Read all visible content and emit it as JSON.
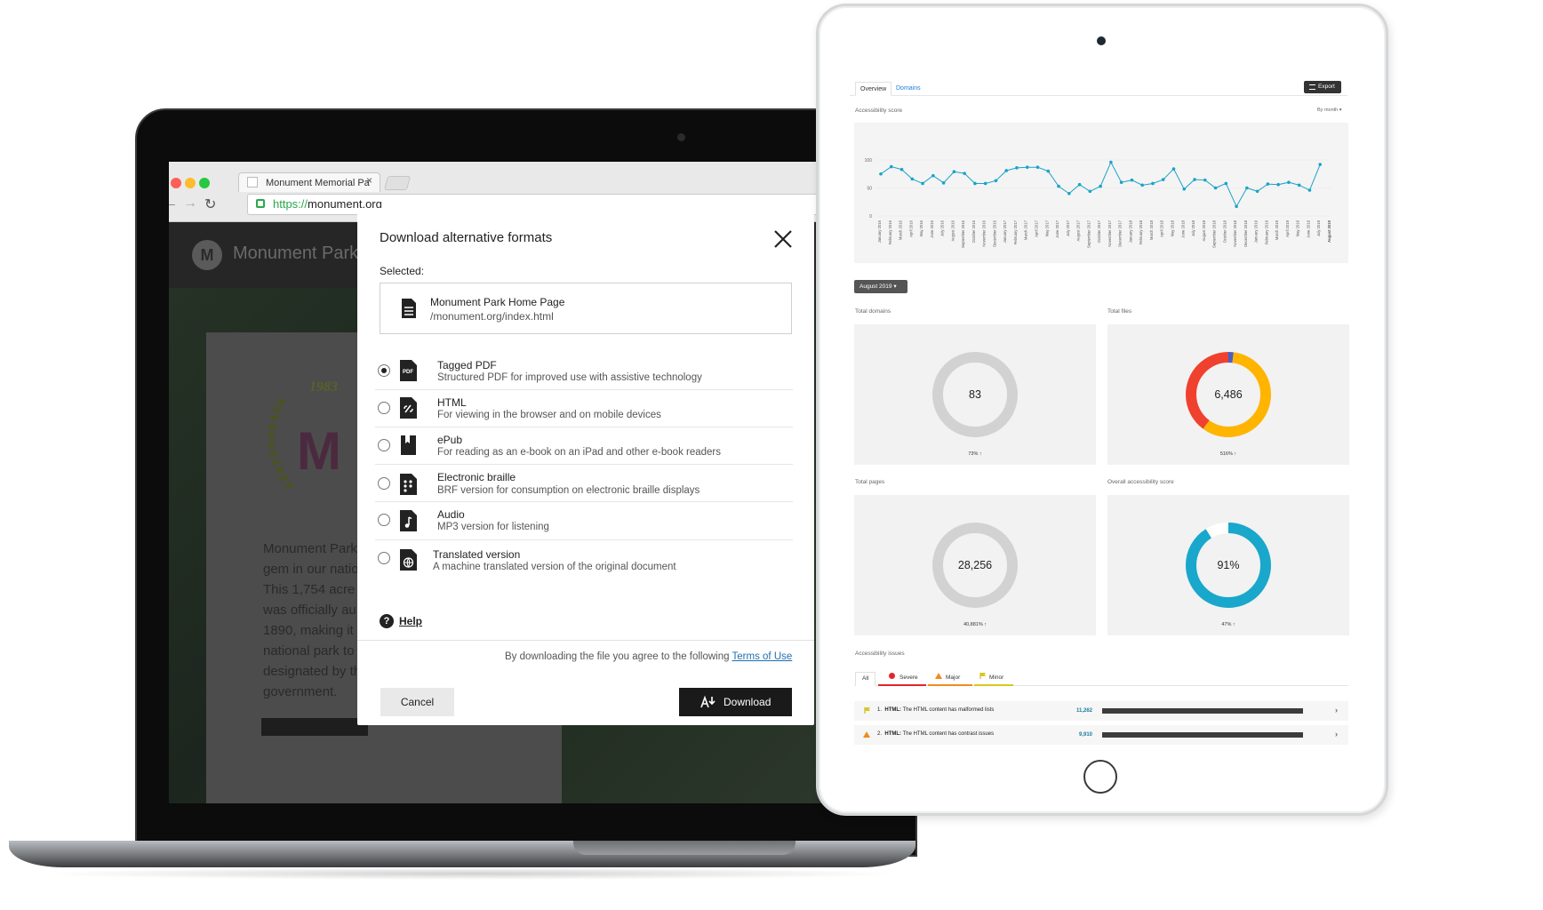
{
  "browser": {
    "tab_title": "Monument Memorial Pa",
    "tab_close": "×",
    "url_scheme": "https://",
    "url_host": "monument.org"
  },
  "site": {
    "logo_letter": "M",
    "name": "Monument Park",
    "emblem_year": "1983",
    "emblem_letter": "M",
    "body_lines": [
      "Monument Park",
      "gem in our natio",
      "This 1,754 acre",
      "was officially au",
      "1890, making it t",
      "national park to",
      "designated by th",
      "government."
    ]
  },
  "modal": {
    "title": "Download alternative formats",
    "selected_label": "Selected:",
    "selected_name": "Monument Park Home Page",
    "selected_path": "/monument.org/index.html",
    "options": [
      {
        "label": "Tagged PDF",
        "desc": "Structured PDF for improved use with assistive technology",
        "icon": "pdf-file-icon",
        "checked": true
      },
      {
        "label": "HTML",
        "desc": "For viewing in the browser and on mobile devices",
        "icon": "html-file-icon",
        "checked": false
      },
      {
        "label": "ePub",
        "desc": "For reading as an e-book on an iPad and other e-book readers",
        "icon": "book-icon",
        "checked": false
      },
      {
        "label": "Electronic braille",
        "desc": "BRF version for consumption on electronic braille displays",
        "icon": "braille-file-icon",
        "checked": false
      },
      {
        "label": "Audio",
        "desc": "MP3 version for listening",
        "icon": "audio-file-icon",
        "checked": false
      },
      {
        "label": "Translated version",
        "desc": "A machine translated version of the original document",
        "icon": "globe-file-icon",
        "checked": false
      }
    ],
    "help_glyph": "?",
    "help_label": "Help",
    "agree_text": "By downloading the file you agree to the following",
    "terms_label": "Terms of Use",
    "cancel_label": "Cancel",
    "download_label": "Download"
  },
  "dashboard": {
    "tabs": [
      "Overview",
      "Domains"
    ],
    "export_label": "Export",
    "score_title": "Accessibility score",
    "period_select": "By month",
    "month_select": "August 2019",
    "chart_data": {
      "type": "line",
      "title": "Accessibility score",
      "y_ticks": [
        "100",
        "50",
        "0"
      ],
      "ylim": [
        0,
        100
      ],
      "color": "#1aa3c8",
      "x": [
        "January 2016",
        "February 2016",
        "March 2016",
        "April 2016",
        "May 2016",
        "June 2016",
        "July 2016",
        "August 2016",
        "September 2016",
        "October 2016",
        "November 2016",
        "December 2016",
        "January 2017",
        "February 2017",
        "March 2017",
        "April 2017",
        "May 2017",
        "June 2017",
        "July 2017",
        "August 2017",
        "September 2017",
        "October 2017",
        "November 2017",
        "December 2017",
        "January 2018",
        "February 2018",
        "March 2018",
        "April 2018",
        "May 2018",
        "June 2018",
        "July 2018",
        "August 2018",
        "September 2018",
        "October 2018",
        "November 2018",
        "December 2018",
        "January 2019",
        "February 2019",
        "March 2019",
        "April 2019",
        "May 2019",
        "June 2019",
        "July 2019",
        "August 2019"
      ],
      "values": [
        75,
        88,
        83,
        66,
        58,
        72,
        59,
        79,
        76,
        58,
        58,
        63,
        81,
        86,
        87,
        87,
        80,
        53,
        40,
        56,
        44,
        53,
        96,
        60,
        64,
        55,
        58,
        65,
        84,
        48,
        65,
        64,
        50,
        58,
        17,
        50,
        44,
        57,
        56,
        60,
        55,
        46,
        92
      ]
    },
    "cards": [
      {
        "title": "Total domains",
        "value": "83",
        "sub": "73% ↑",
        "segments": [
          {
            "pct": 100,
            "color": "#d2d2d2"
          }
        ]
      },
      {
        "title": "Total files",
        "value": "6,486",
        "sub": "516% ↑",
        "segments": [
          {
            "pct": 2,
            "color": "#4a5fc1"
          },
          {
            "pct": 58,
            "color": "#ffb400"
          },
          {
            "pct": 40,
            "color": "#f0412e"
          }
        ]
      },
      {
        "title": "Total pages",
        "value": "28,256",
        "sub": "40,881% ↑",
        "segments": [
          {
            "pct": 100,
            "color": "#d2d2d2"
          }
        ]
      },
      {
        "title": "Overall accessibility score",
        "value": "91%",
        "sub": "47% ↑",
        "segments": [
          {
            "pct": 91,
            "color": "#19a7cc"
          },
          {
            "pct": 9,
            "color": "#ffffff"
          }
        ]
      }
    ],
    "issues_title": "Accessibility issues",
    "issue_tabs": [
      {
        "label": "All",
        "color": "#ffffff"
      },
      {
        "label": "Severe",
        "color": "#e3262d"
      },
      {
        "label": "Major",
        "color": "#f08c1e"
      },
      {
        "label": "Minor",
        "color": "#d7c81e"
      }
    ],
    "issues": [
      {
        "num": "1.",
        "tag": "HTML:",
        "text": "The HTML content has malformed lists",
        "count": "11,262",
        "bar_pct": 100,
        "icon": "flag-icon"
      },
      {
        "num": "2.",
        "tag": "HTML:",
        "text": "The HTML content has contrast issues",
        "count": "9,910",
        "bar_pct": 100,
        "icon": "warning-icon"
      }
    ]
  }
}
